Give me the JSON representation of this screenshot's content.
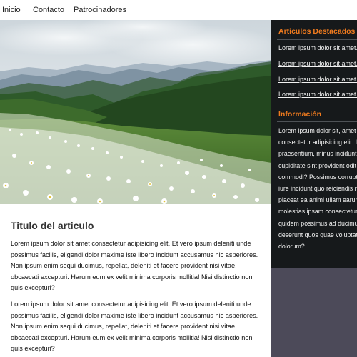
{
  "nav": {
    "items": [
      {
        "label": "Inicio"
      },
      {
        "label": "Contacto"
      },
      {
        "label": "Patrocinadores"
      }
    ]
  },
  "hero": {
    "alt": "Campo de flores blancas con montañas al fondo"
  },
  "article": {
    "title": "Titulo del articulo",
    "paragraphs": [
      "Lorem ipsum dolor sit amet consectetur adipisicing elit. Et vero ipsum deleniti unde possimus facilis, eligendi dolor maxime iste libero incidunt accusamus hic asperiores. Non ipsum enim sequi ducimus, repellat, deleniti et facere provident nisi vitae, obcaecati excepturi. Harum eum ex velit minima corporis mollitia! Nisi distinctio non quis excepturi?",
      "Lorem ipsum dolor sit amet consectetur adipisicing elit. Et vero ipsum deleniti unde possimus facilis, eligendi dolor maxime iste libero incidunt accusamus hic asperiores. Non ipsum enim sequi ducimus, repellat, deleniti et facere provident nisi vitae, obcaecati excepturi. Harum eum ex velit minima corporis mollitia! Nisi distinctio non quis excepturi?"
    ]
  },
  "sidebar": {
    "featured_title": "Articulos Destacados",
    "featured_items": [
      {
        "label": "Lorem ipsum dolor sit amet."
      },
      {
        "label": "Lorem ipsum dolor sit amet."
      },
      {
        "label": "Lorem ipsum dolor sit amet."
      },
      {
        "label": "Lorem ipsum dolor sit amet."
      }
    ],
    "info_title": "Información",
    "info_text": "Lorem ipsum dolor sit, amet consectetur adipisicing elit. Itaque praesentium, minus incidunt deserunt cupiditate sint provident odit inventore commodi? Possimus corrupti ipsum iure incidunt quo reiciendis nulla placeat ea animi ullam earum molestias ipsam consectetur cumque quidem possimus ad ducimus a deserunt quos quae voluptatum. Quis dolorum?"
  },
  "colors": {
    "accent": "#ee7a1e",
    "sidebar_dark": "#16191b",
    "sidebar_bottom": "#4c4a59",
    "text_light": "#f2f2f2"
  }
}
